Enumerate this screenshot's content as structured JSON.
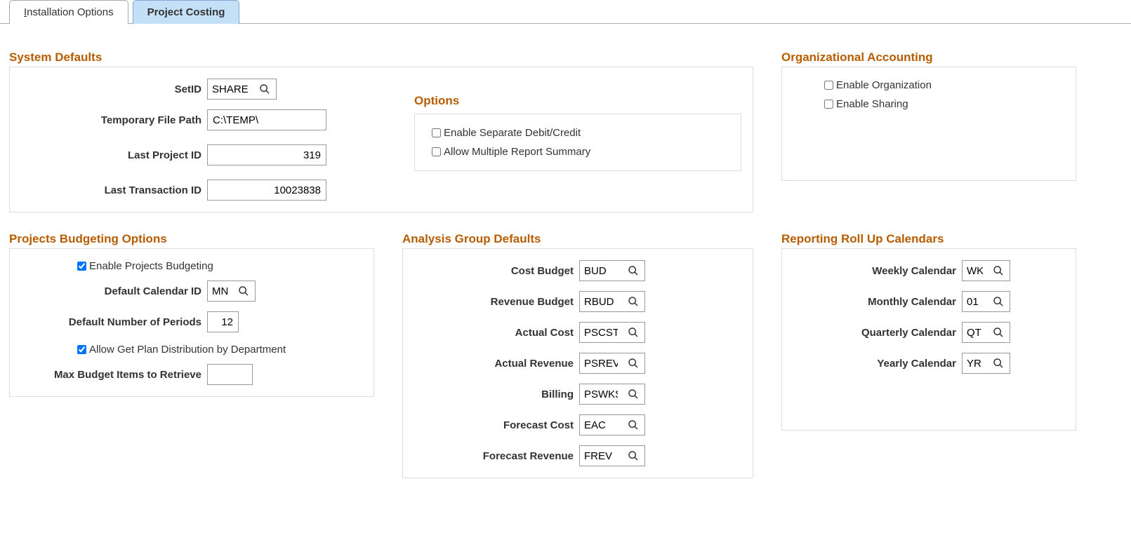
{
  "tabs": {
    "installation": "Installation Options",
    "installation_prefix": "I",
    "installation_suffix": "nstallation Options",
    "project_costing": "Project Costing"
  },
  "system_defaults": {
    "title": "System Defaults",
    "set_id_label": "SetID",
    "set_id_value": "SHARE",
    "temp_path_label": "Temporary File Path",
    "temp_path_value": "C:\\TEMP\\",
    "last_project_id_label": "Last Project ID",
    "last_project_id_value": "319",
    "last_tx_id_label": "Last Transaction ID",
    "last_tx_id_value": "10023838",
    "options_title": "Options",
    "enable_sep_label": "Enable Separate Debit/Credit",
    "allow_multi_label": "Allow Multiple Report Summary"
  },
  "org_accounting": {
    "title": "Organizational Accounting",
    "enable_org_label": "Enable Organization",
    "enable_sharing_label": "Enable Sharing"
  },
  "budgeting": {
    "title": "Projects Budgeting Options",
    "enable_label": "Enable Projects Budgeting",
    "calendar_id_label": "Default Calendar ID",
    "calendar_id_value": "MN",
    "periods_label": "Default Number of Periods",
    "periods_value": "12",
    "allow_plan_label": "Allow Get Plan Distribution by Department",
    "max_items_label": "Max Budget Items to Retrieve",
    "max_items_value": ""
  },
  "analysis": {
    "title": "Analysis Group Defaults",
    "cost_budget_label": "Cost Budget",
    "cost_budget_value": "BUD",
    "revenue_budget_label": "Revenue Budget",
    "revenue_budget_value": "RBUD",
    "actual_cost_label": "Actual Cost",
    "actual_cost_value": "PSCST",
    "actual_revenue_label": "Actual Revenue",
    "actual_revenue_value": "PSREV",
    "billing_label": "Billing",
    "billing_value": "PSWKS",
    "forecast_cost_label": "Forecast Cost",
    "forecast_cost_value": "EAC",
    "forecast_revenue_label": "Forecast Revenue",
    "forecast_revenue_value": "FREV"
  },
  "reporting": {
    "title": "Reporting Roll Up Calendars",
    "weekly_label": "Weekly Calendar",
    "weekly_value": "WK",
    "monthly_label": "Monthly Calendar",
    "monthly_value": "01",
    "quarterly_label": "Quarterly Calendar",
    "quarterly_value": "QT",
    "yearly_label": "Yearly Calendar",
    "yearly_value": "YR"
  }
}
